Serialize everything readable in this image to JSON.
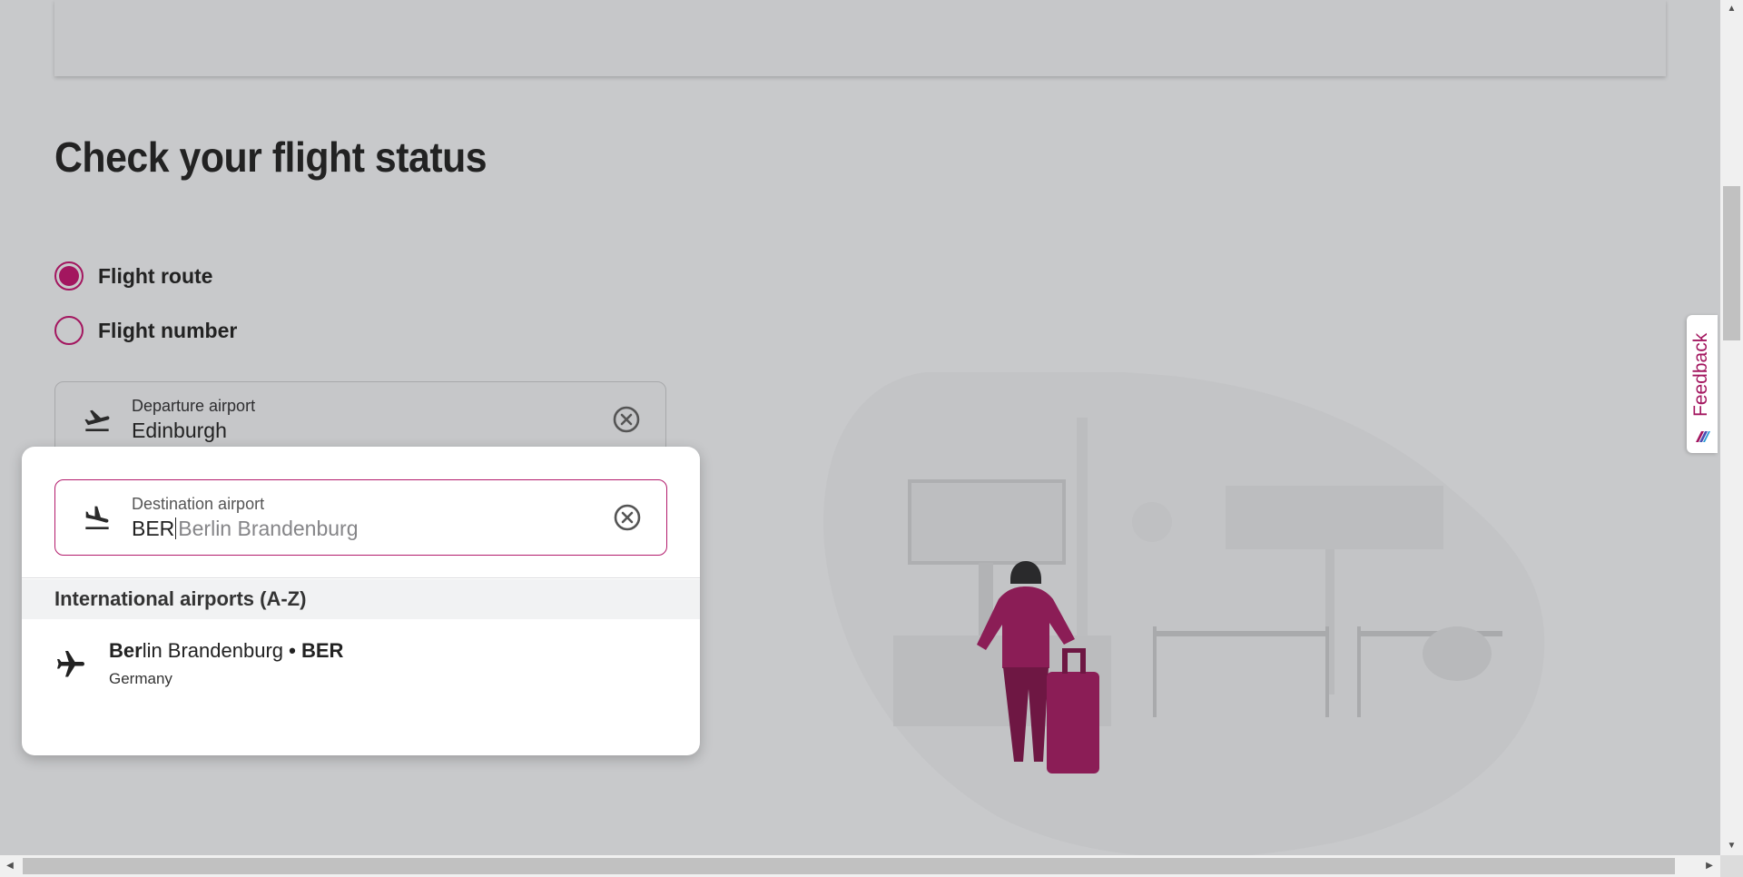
{
  "page": {
    "title": "Check your flight status"
  },
  "search_type": {
    "options": [
      {
        "label": "Flight route",
        "selected": true
      },
      {
        "label": "Flight number",
        "selected": false
      }
    ]
  },
  "departure": {
    "label": "Departure airport",
    "value": "Edinburgh"
  },
  "destination": {
    "label": "Destination airport",
    "typed": "BER",
    "suggestion": "Berlin Brandenburg"
  },
  "dropdown": {
    "group_header": "International airports (A-Z)",
    "results": [
      {
        "match": "Ber",
        "rest": "lin Brandenburg",
        "separator": " • ",
        "code": "BER",
        "country": "Germany"
      }
    ]
  },
  "feedback": {
    "label": "Feedback"
  },
  "colors": {
    "accent": "#a3165f",
    "background": "#c8c9cb"
  },
  "icons": {
    "departure": "plane-takeoff-icon",
    "arrival": "plane-landing-icon",
    "clear": "close-circle-icon",
    "result": "airplane-icon"
  }
}
